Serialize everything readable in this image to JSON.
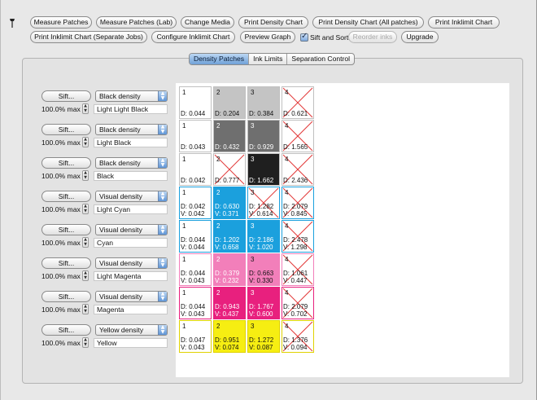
{
  "toolbar": {
    "buttons": [
      {
        "label": "Measure Patches",
        "disabled": false
      },
      {
        "label": "Measure Patches (Lab)",
        "disabled": false
      },
      {
        "label": "Change Media",
        "disabled": false
      },
      {
        "label": "Print Density Chart",
        "disabled": false
      },
      {
        "label": "Print Density Chart (All patches)",
        "disabled": false
      },
      {
        "label": "Print Inklimit Chart",
        "disabled": false
      },
      {
        "label": "Print Inklimit Chart (Separate Jobs)",
        "disabled": false
      },
      {
        "label": "Configure Inklimit Chart",
        "disabled": false
      },
      {
        "label": "Preview Graph",
        "disabled": false
      },
      {
        "label": "Reorder inks",
        "disabled": true
      },
      {
        "label": "Upgrade",
        "disabled": false
      }
    ],
    "sift_and_sort": {
      "label": "Sift and Sort",
      "checked": true
    }
  },
  "tabs": [
    {
      "label": "Density Patches",
      "active": true
    },
    {
      "label": "Ink Limits",
      "active": false
    },
    {
      "label": "Separation Control",
      "active": false
    }
  ],
  "colors": {
    "white_patch": "#ffffff",
    "light_black": "#c4c4c4",
    "black_mid": "#6f6f6f",
    "black_full": "#1f1f1f",
    "cyan": "#1ba0dd",
    "light_magenta": "#f27fba",
    "magenta": "#e8207e",
    "yellow": "#f6ee12",
    "cross": "#e23a3a"
  },
  "inks": [
    {
      "sift_label": "Sift...",
      "density_type": "Black density",
      "max": "100.0% max",
      "name": "Light Light Black",
      "patches": [
        {
          "num": "1",
          "d": "D: 0.044",
          "v": null,
          "fill": "white_patch",
          "dark_text": true,
          "crossed": false,
          "border": "#c0c0c0"
        },
        {
          "num": "2",
          "d": "D: 0.204",
          "v": null,
          "fill": "light_black",
          "dark_text": true,
          "crossed": false,
          "border": "#c0c0c0"
        },
        {
          "num": "3",
          "d": "D: 0.384",
          "v": null,
          "fill": "light_black",
          "dark_text": true,
          "crossed": false,
          "border": "#c0c0c0"
        },
        {
          "num": "4",
          "d": "D: 0.621",
          "v": null,
          "fill": "white_patch",
          "dark_text": true,
          "crossed": true,
          "border": "#c0c0c0"
        }
      ]
    },
    {
      "sift_label": "Sift...",
      "density_type": "Black density",
      "max": "100.0% max",
      "name": "Light Black",
      "patches": [
        {
          "num": "1",
          "d": "D: 0.043",
          "v": null,
          "fill": "white_patch",
          "dark_text": true,
          "crossed": false,
          "border": "#c0c0c0"
        },
        {
          "num": "2",
          "d": "D: 0.432",
          "v": null,
          "fill": "black_mid",
          "dark_text": false,
          "crossed": false,
          "border": "#c0c0c0"
        },
        {
          "num": "3",
          "d": "D: 0.929",
          "v": null,
          "fill": "black_mid",
          "dark_text": false,
          "crossed": false,
          "border": "#c0c0c0"
        },
        {
          "num": "4",
          "d": "D: 1.565",
          "v": null,
          "fill": "white_patch",
          "dark_text": true,
          "crossed": true,
          "border": "#c0c0c0"
        }
      ]
    },
    {
      "sift_label": "Sift...",
      "density_type": "Black density",
      "max": "100.0% max",
      "name": "Black",
      "patches": [
        {
          "num": "1",
          "d": "D: 0.042",
          "v": null,
          "fill": "white_patch",
          "dark_text": true,
          "crossed": false,
          "border": "#c0c0c0"
        },
        {
          "num": "2",
          "d": "D: 0.777",
          "v": null,
          "fill": "white_patch",
          "dark_text": true,
          "crossed": true,
          "border": "#c0c0c0"
        },
        {
          "num": "3",
          "d": "D: 1.662",
          "v": null,
          "fill": "black_full",
          "dark_text": false,
          "crossed": false,
          "border": "#c0c0c0"
        },
        {
          "num": "4",
          "d": "D: 2.436",
          "v": null,
          "fill": "white_patch",
          "dark_text": true,
          "crossed": true,
          "border": "#c0c0c0"
        }
      ]
    },
    {
      "sift_label": "Sift...",
      "density_type": "Visual density",
      "max": "100.0% max",
      "name": "Light Cyan",
      "patches": [
        {
          "num": "1",
          "d": "D: 0.042",
          "v": "V: 0.042",
          "fill": "white_patch",
          "dark_text": true,
          "crossed": false,
          "border": "#1ba0dd"
        },
        {
          "num": "2",
          "d": "D: 0.630",
          "v": "V: 0.371",
          "fill": "cyan",
          "dark_text": false,
          "crossed": false,
          "border": "#1ba0dd"
        },
        {
          "num": "3",
          "d": "D: 1.282",
          "v": "V: 0.614",
          "fill": "white_patch",
          "dark_text": true,
          "crossed": true,
          "border": "#1ba0dd"
        },
        {
          "num": "4",
          "d": "D: 2.079",
          "v": "V: 0.845",
          "fill": "white_patch",
          "dark_text": true,
          "crossed": true,
          "border": "#1ba0dd"
        }
      ]
    },
    {
      "sift_label": "Sift...",
      "density_type": "Visual density",
      "max": "100.0% max",
      "name": "Cyan",
      "patches": [
        {
          "num": "1",
          "d": "D: 0.044",
          "v": "V: 0.044",
          "fill": "white_patch",
          "dark_text": true,
          "crossed": false,
          "border": "#1ba0dd"
        },
        {
          "num": "2",
          "d": "D: 1.202",
          "v": "V: 0.658",
          "fill": "cyan",
          "dark_text": false,
          "crossed": false,
          "border": "#1ba0dd"
        },
        {
          "num": "3",
          "d": "D: 2.186",
          "v": "V: 1.020",
          "fill": "cyan",
          "dark_text": false,
          "crossed": false,
          "border": "#1ba0dd"
        },
        {
          "num": "4",
          "d": "D: 2.478",
          "v": "V: 1.298",
          "fill": "white_patch",
          "dark_text": true,
          "crossed": true,
          "border": "#1ba0dd"
        }
      ]
    },
    {
      "sift_label": "Sift...",
      "density_type": "Visual density",
      "max": "100.0% max",
      "name": "Light Magenta",
      "patches": [
        {
          "num": "1",
          "d": "D: 0.044",
          "v": "V: 0.043",
          "fill": "white_patch",
          "dark_text": true,
          "crossed": false,
          "border": "#f27fba"
        },
        {
          "num": "2",
          "d": "D: 0.379",
          "v": "V: 0.232",
          "fill": "light_magenta",
          "dark_text": false,
          "crossed": false,
          "border": "#f27fba"
        },
        {
          "num": "3",
          "d": "D: 0.663",
          "v": "V: 0.330",
          "fill": "light_magenta",
          "dark_text": true,
          "crossed": false,
          "border": "#f27fba"
        },
        {
          "num": "4",
          "d": "D: 1.061",
          "v": "V: 0.447",
          "fill": "white_patch",
          "dark_text": true,
          "crossed": true,
          "border": "#f27fba"
        }
      ]
    },
    {
      "sift_label": "Sift...",
      "density_type": "Visual density",
      "max": "100.0% max",
      "name": "Magenta",
      "patches": [
        {
          "num": "1",
          "d": "D: 0.044",
          "v": "V: 0.043",
          "fill": "white_patch",
          "dark_text": true,
          "crossed": false,
          "border": "#e8207e"
        },
        {
          "num": "2",
          "d": "D: 0.943",
          "v": "V: 0.437",
          "fill": "magenta",
          "dark_text": false,
          "crossed": false,
          "border": "#e8207e"
        },
        {
          "num": "3",
          "d": "D: 1.767",
          "v": "V: 0.600",
          "fill": "magenta",
          "dark_text": false,
          "crossed": false,
          "border": "#e8207e"
        },
        {
          "num": "4",
          "d": "D: 2.079",
          "v": "V: 0.702",
          "fill": "white_patch",
          "dark_text": true,
          "crossed": true,
          "border": "#e8207e"
        }
      ]
    },
    {
      "sift_label": "Sift...",
      "density_type": "Yellow density",
      "max": "100.0% max",
      "name": "Yellow",
      "patches": [
        {
          "num": "1",
          "d": "D: 0.047",
          "v": "V: 0.043",
          "fill": "white_patch",
          "dark_text": true,
          "crossed": false,
          "border": "#e0d200"
        },
        {
          "num": "2",
          "d": "D: 0.951",
          "v": "V: 0.074",
          "fill": "yellow",
          "dark_text": true,
          "crossed": false,
          "border": "#e0d200"
        },
        {
          "num": "3",
          "d": "D: 1.272",
          "v": "V: 0.087",
          "fill": "yellow",
          "dark_text": true,
          "crossed": false,
          "border": "#e0d200"
        },
        {
          "num": "4",
          "d": "D: 1.376",
          "v": "V: 0.094",
          "fill": "white_patch",
          "dark_text": true,
          "crossed": true,
          "border": "#e0d200"
        }
      ]
    }
  ]
}
